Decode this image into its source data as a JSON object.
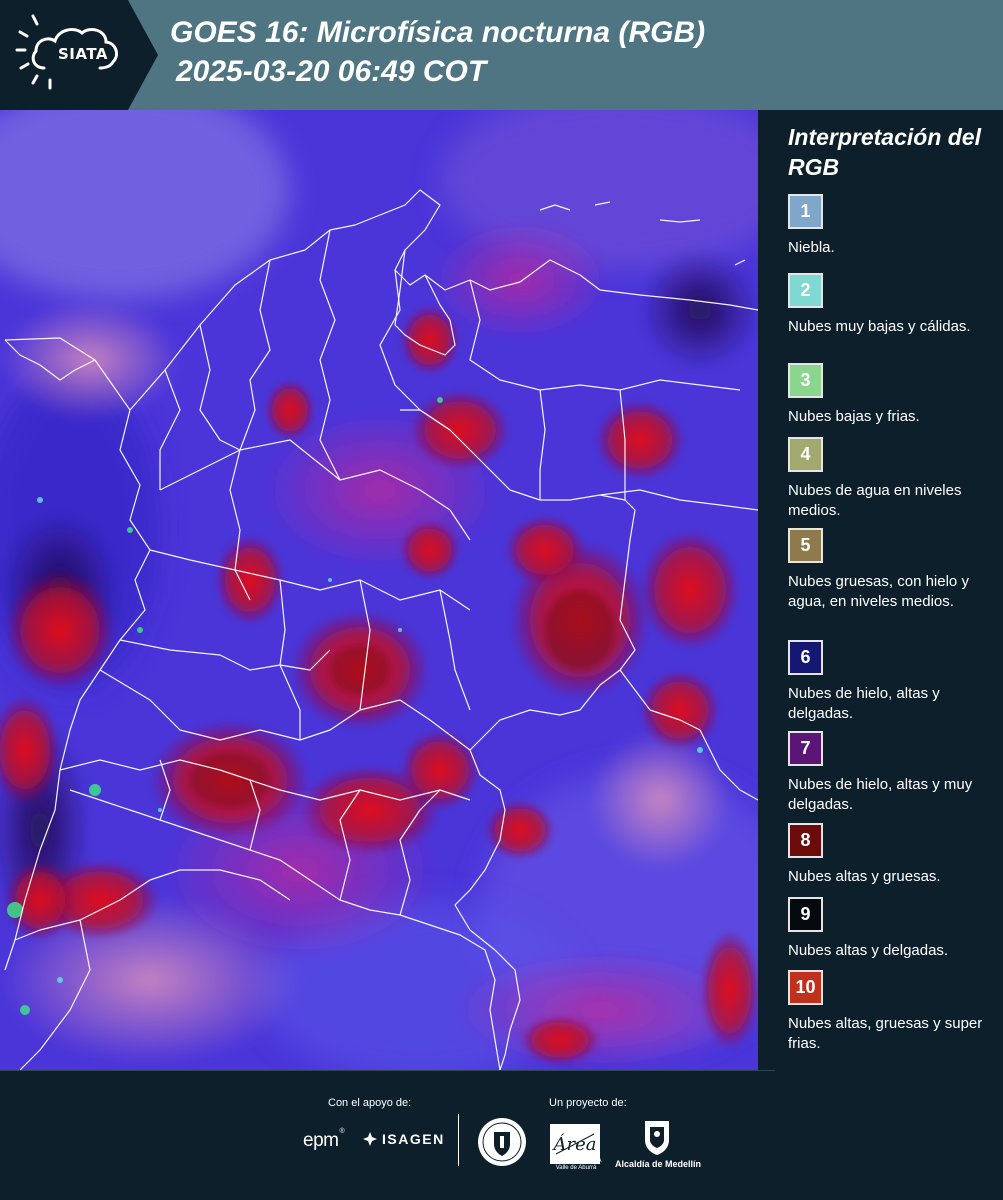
{
  "header": {
    "logo_text": "SIATA",
    "title_line1": "GOES 16: Microfísica nocturna (RGB)",
    "title_line2": "2025-03-20 06:49 COT"
  },
  "map": {
    "background_color": "#4a35d9",
    "border_color": "#ffffff"
  },
  "legend": {
    "title": "Interpretación del RGB",
    "items": [
      {
        "number": "1",
        "color": "#7fa7c9",
        "label": "Niebla."
      },
      {
        "number": "2",
        "color": "#7fd8d2",
        "label": "Nubes muy bajas y cálidas."
      },
      {
        "number": "3",
        "color": "#8ad68f",
        "label": "Nubes bajas y frias."
      },
      {
        "number": "4",
        "color": "#a2a96e",
        "label": "Nubes de agua en niveles medios."
      },
      {
        "number": "5",
        "color": "#8f7a4b",
        "label": "Nubes gruesas, con hielo y agua, en niveles medios."
      },
      {
        "number": "6",
        "color": "#141872",
        "label": "Nubes de hielo, altas y delgadas."
      },
      {
        "number": "7",
        "color": "#5b1576",
        "label": "Nubes de hielo, altas y muy delgadas."
      },
      {
        "number": "8",
        "color": "#6b0b0b",
        "label": "Nubes altas y gruesas."
      },
      {
        "number": "9",
        "color": "#050a0f",
        "label": "Nubes altas y delgadas."
      },
      {
        "number": "10",
        "color": "#c0301c",
        "label": "Nubes altas, gruesas y super frias."
      }
    ]
  },
  "footer": {
    "support_label": "Con el apoyo de:",
    "project_label": "Un proyecto de:",
    "sponsor1": "epm",
    "sponsor1_mark": "®",
    "sponsor2": "ISAGEN",
    "partner_metro_logo": "Área",
    "partner_metro": "METROPOLITANA Valle de Aburrá",
    "partner_alcaldia": "Alcaldía de Medellín"
  }
}
